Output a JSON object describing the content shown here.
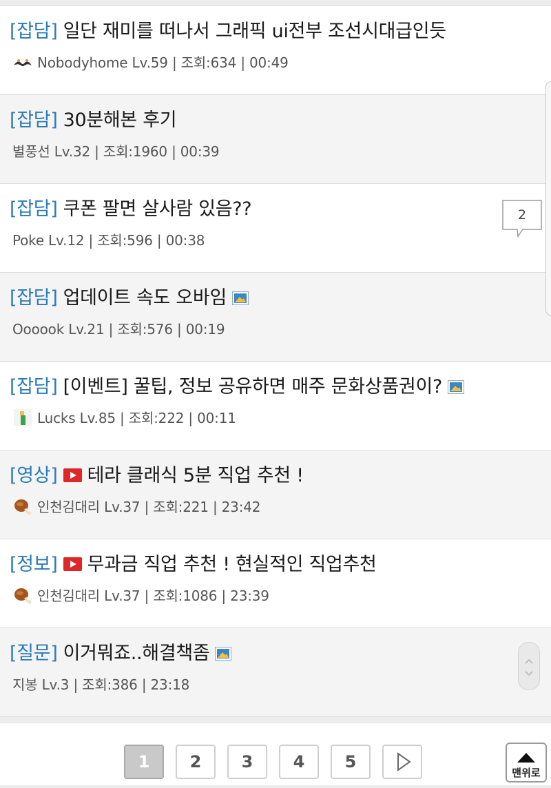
{
  "posts": [
    {
      "category": "[잡담]",
      "title": "일단 재미를 떠나서 그래픽 ui전부 조선시대급인듯",
      "user": "Nobodyhome",
      "level": "Lv.59",
      "views": "조회:634",
      "time": "00:49",
      "level_icon": "mustache-level-icon",
      "has_image": false,
      "has_video": false,
      "comments": ""
    },
    {
      "category": "[잡담]",
      "title": "30분해본 후기",
      "user": "별풍선",
      "level": "Lv.32",
      "views": "조회:1960",
      "time": "00:39",
      "level_icon": "",
      "has_image": false,
      "has_video": false,
      "comments": ""
    },
    {
      "category": "[잡담]",
      "title": "쿠폰 팔면 살사람 있음??",
      "user": "Poke",
      "level": "Lv.12",
      "views": "조회:596",
      "time": "00:38",
      "level_icon": "",
      "has_image": false,
      "has_video": false,
      "comments": "2"
    },
    {
      "category": "[잡담]",
      "title": "업데이트 속도 오바임",
      "user": "Oooook",
      "level": "Lv.21",
      "views": "조회:576",
      "time": "00:19",
      "level_icon": "",
      "has_image": true,
      "has_video": false,
      "comments": ""
    },
    {
      "category": "[잡담]",
      "title": "[이벤트] 꿀팁, 정보 공유하면 매주 문화상품권이?",
      "user": "Lucks",
      "level": "Lv.85",
      "views": "조회:222",
      "time": "00:11",
      "level_icon": "bottle-level-icon",
      "has_image": true,
      "has_video": false,
      "comments": ""
    },
    {
      "category": "[영상]",
      "title": "테라 클래식 5분 직업 추천 !",
      "user": "인천김대리",
      "level": "Lv.37",
      "views": "조회:221",
      "time": "23:42",
      "level_icon": "chicken-leg-level-icon",
      "has_image": false,
      "has_video": true,
      "comments": ""
    },
    {
      "category": "[정보]",
      "title": "무과금 직업 추천 ! 현실적인 직업추천",
      "user": "인천김대리",
      "level": "Lv.37",
      "views": "조회:1086",
      "time": "23:39",
      "level_icon": "chicken-leg-level-icon",
      "has_image": false,
      "has_video": true,
      "comments": ""
    },
    {
      "category": "[질문]",
      "title": "이거뭐죠..해결책좀",
      "user": "지봉",
      "level": "Lv.3",
      "views": "조회:386",
      "time": "23:18",
      "level_icon": "",
      "has_image": true,
      "has_video": false,
      "comments": ""
    }
  ],
  "pagination": {
    "pages": [
      "1",
      "2",
      "3",
      "4",
      "5"
    ],
    "current": "1",
    "next_icon": "play-triangle-icon",
    "top_label": "맨위로",
    "top_icon": "up-triangle-icon"
  },
  "colors": {
    "category": "#2a7ab8",
    "video_icon": "#e02626",
    "image_icon": "#3c86c4"
  }
}
